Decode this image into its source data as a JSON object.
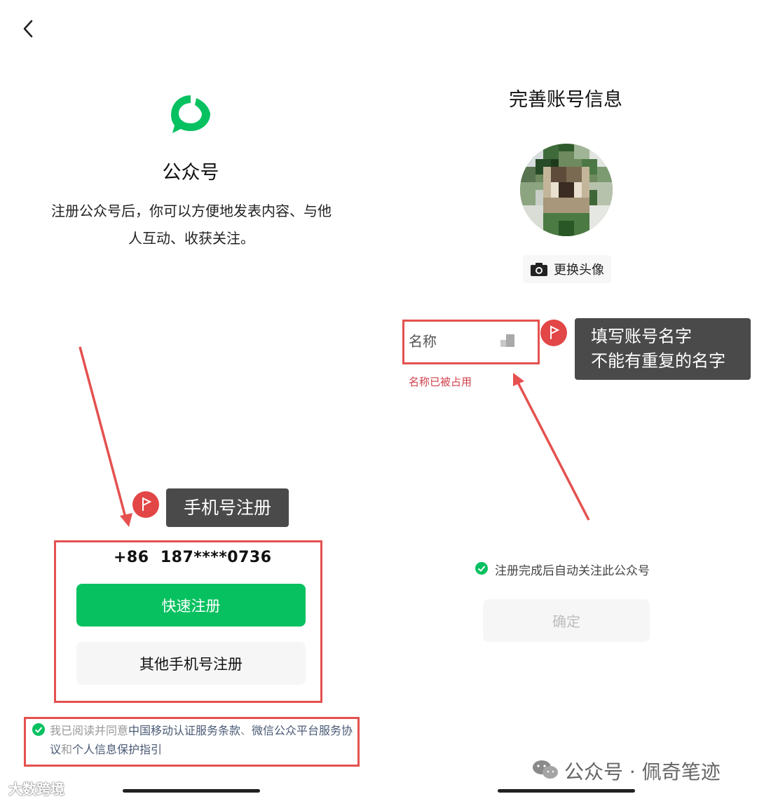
{
  "left_panel": {
    "app_name": "公众号",
    "intro_line1": "注册公众号后，你可以方便地发表内容、与他",
    "intro_line2": "人互动、收获关注。",
    "callout_label": "手机号注册",
    "phone_number": "+86  187****0736",
    "quick_register_label": "快速注册",
    "other_phone_register_label": "其他手机号注册",
    "agreement": {
      "prefix": "我已阅读并同意",
      "link1": "中国移动认证服务条款",
      "sep": "、",
      "link2": "微信公众平台服务协议",
      "and": "和",
      "link3": "个人信息保护指引"
    }
  },
  "right_panel": {
    "title": "完善账号信息",
    "change_avatar_label": "更换头像",
    "name_field_label": "名称",
    "name_error": "名称已被占用",
    "callout_line1": "填写账号名字",
    "callout_line2": "不能有重复的名字",
    "auto_follow_text": "注册完成后自动关注此公众号",
    "confirm_label": "确定"
  },
  "watermarks": {
    "left": "大数跨境",
    "right": "公众号 · 佩奇笔迹"
  },
  "icons": [
    "back-chevron-icon",
    "wechat-official-account-logo",
    "flag-icon",
    "check-icon",
    "camera-icon",
    "wechat-icon"
  ],
  "colors": {
    "brand_green": "#07c160",
    "annotation_red": "#e4514f",
    "callout_gray": "#4a4a4a",
    "error_red": "#d0404a"
  }
}
